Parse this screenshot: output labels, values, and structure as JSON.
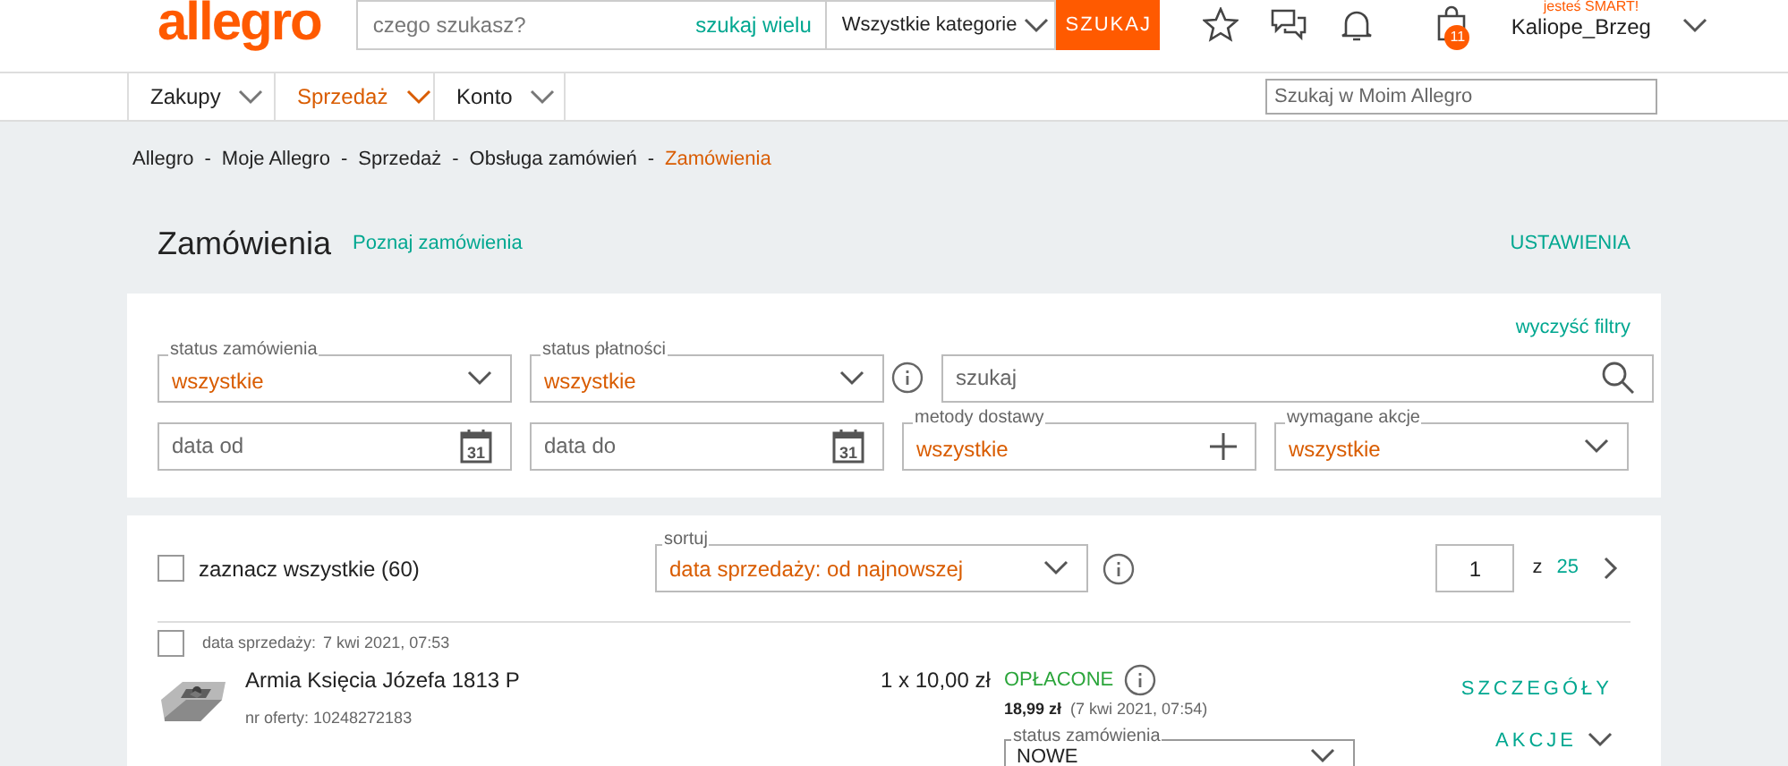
{
  "header": {
    "logo": "allegro",
    "search": {
      "placeholder": "czego szukasz?"
    },
    "multi_search": "szukaj wielu",
    "category": "Wszystkie kategorie",
    "search_button": "SZUKAJ",
    "cart_badge": "11",
    "smart_label": "jesteś SMART!",
    "user": "Kaliope_Brzeg"
  },
  "nav": {
    "items": [
      {
        "label": "Zakupy",
        "selected": false
      },
      {
        "label": "Sprzedaż",
        "selected": true
      },
      {
        "label": "Konto",
        "selected": false
      }
    ],
    "search": {
      "placeholder": "Szukaj w Moim Allegro"
    }
  },
  "breadcrumb": [
    {
      "label": "Allegro",
      "current": false
    },
    {
      "label": "Moje Allegro",
      "current": false
    },
    {
      "label": "Sprzedaż",
      "current": false
    },
    {
      "label": "Obsługa zamówień",
      "current": false
    },
    {
      "label": "Zamówienia",
      "current": true
    }
  ],
  "breadcrumb_separator": "-",
  "page": {
    "title": "Zamówienia",
    "intro_link": "Poznaj zamówienia",
    "settings": "USTAWIENIA"
  },
  "filters": {
    "clear": "wyczyść filtry",
    "rows": [
      [
        {
          "kind": "select",
          "label": "status zamówienia",
          "value": "wszystkie"
        },
        {
          "kind": "select",
          "label": "status płatności",
          "value": "wszystkie",
          "info": true
        },
        {
          "kind": "search",
          "placeholder": "szukaj",
          "wide": true
        }
      ],
      [
        {
          "kind": "date",
          "placeholder": "data od",
          "day": "31"
        },
        {
          "kind": "date",
          "placeholder": "data do",
          "day": "31"
        },
        {
          "kind": "add",
          "label": "metody dostawy",
          "value": "wszystkie"
        },
        {
          "kind": "select",
          "label": "wymagane akcje",
          "value": "wszystkie"
        }
      ]
    ]
  },
  "list": {
    "select_all": {
      "label": "zaznacz wszystkie (60)",
      "checked": false
    },
    "sort": {
      "label": "sortuj",
      "value": "data sprzedaży: od najnowszej"
    },
    "page": "1",
    "of": "z",
    "pages": "25"
  },
  "orders": [
    {
      "checked": false,
      "date_label": "data sprzedaży:",
      "date": "7 kwi 2021, 07:53",
      "title": "Armia Księcia Józefa 1813 P",
      "offer": "nr oferty: 10248272183",
      "quantity": "1 x 10,00 zł",
      "payment_status": "OPŁACONE",
      "total": "18,99 zł",
      "paid_at": "(7 kwi 2021, 07:54)",
      "status_label": "status zamówienia",
      "status": "NOWE",
      "details": "SZCZEGÓŁY",
      "actions": "AKCJE"
    }
  ]
}
